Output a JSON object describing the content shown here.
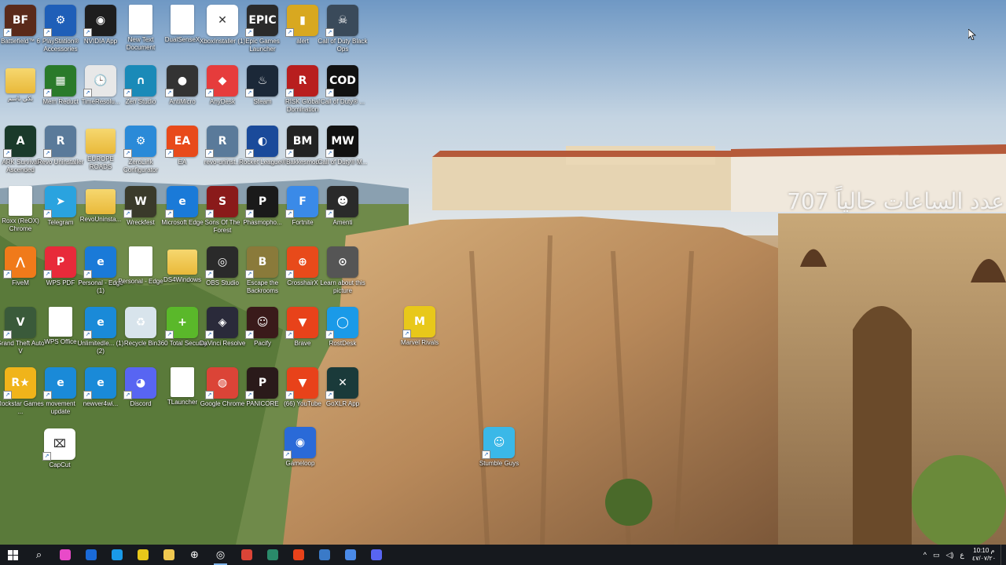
{
  "desktop": {
    "overlay_text": "عدد الساعات حالياً 707",
    "icons": [
      {
        "label": "Battlefield™ 6",
        "kind": "app",
        "color": "#5a2a1a",
        "glyph": "BF",
        "shortcut": true
      },
      {
        "label": "PlayStation® Accessories",
        "kind": "app",
        "color": "#1f5fb8",
        "glyph": "⚙",
        "shortcut": true
      },
      {
        "label": "NVIDIA App",
        "kind": "app",
        "color": "#1e1e1e",
        "glyph": "◉",
        "shortcut": true
      },
      {
        "label": "New Text Document",
        "kind": "file",
        "color": "#ffffff",
        "glyph": "",
        "shortcut": false
      },
      {
        "label": "DualSenseX",
        "kind": "file",
        "color": "#ffffff",
        "glyph": "",
        "shortcut": false
      },
      {
        "label": "XboxInstaller (1)",
        "kind": "app",
        "color": "#ffffff",
        "glyph": "✕",
        "shortcut": false
      },
      {
        "label": "Epic Games Launcher",
        "kind": "app",
        "color": "#2a2a2a",
        "glyph": "EPIC",
        "shortcut": true
      },
      {
        "label": "alert",
        "kind": "app",
        "color": "#d8a820",
        "glyph": "▮",
        "shortcut": true
      },
      {
        "label": "Call of Duty Black Ops",
        "kind": "app",
        "color": "#3a4a5a",
        "glyph": "☠",
        "shortcut": true
      },
      {
        "label": "بكي باسم",
        "kind": "folder",
        "color": "#f0c850",
        "glyph": "",
        "shortcut": false
      },
      {
        "label": "Mem Reduct",
        "kind": "app",
        "color": "#2a7a2a",
        "glyph": "▦",
        "shortcut": true
      },
      {
        "label": "TimeResolu...",
        "kind": "app",
        "color": "#e8e8e8",
        "glyph": "🕒",
        "shortcut": true
      },
      {
        "label": "Zen Studio",
        "kind": "app",
        "color": "#1a8ab8",
        "glyph": "∩",
        "shortcut": true
      },
      {
        "label": "AntiMicro",
        "kind": "app",
        "color": "#333333",
        "glyph": "●",
        "shortcut": true
      },
      {
        "label": "AnyDesk",
        "kind": "app",
        "color": "#e63c3c",
        "glyph": "◆",
        "shortcut": true
      },
      {
        "label": "Steam",
        "kind": "app",
        "color": "#1b2838",
        "glyph": "♨",
        "shortcut": true
      },
      {
        "label": "RISK Global Domination",
        "kind": "app",
        "color": "#b81e1e",
        "glyph": "R",
        "shortcut": true
      },
      {
        "label": "Call of Duty® ...",
        "kind": "app",
        "color": "#111111",
        "glyph": "COD",
        "shortcut": true
      },
      {
        "label": "ARK Survival Ascended",
        "kind": "app",
        "color": "#1a3a2a",
        "glyph": "A",
        "shortcut": true
      },
      {
        "label": "Revo Uninstaller",
        "kind": "app",
        "color": "#5a7a9a",
        "glyph": "R",
        "shortcut": true
      },
      {
        "label": "EUROPE ROADS",
        "kind": "folder",
        "color": "#f0c850",
        "glyph": "",
        "shortcut": false
      },
      {
        "label": "ZeroLink Configurator",
        "kind": "app",
        "color": "#2a8ad8",
        "glyph": "⚙",
        "shortcut": true
      },
      {
        "label": "EA",
        "kind": "app",
        "color": "#e84a1a",
        "glyph": "EA",
        "shortcut": true
      },
      {
        "label": "revo-uninst...",
        "kind": "app",
        "color": "#5a7a9a",
        "glyph": "R",
        "shortcut": true
      },
      {
        "label": "Rocket League®",
        "kind": "app",
        "color": "#1a4a9a",
        "glyph": "◐",
        "shortcut": true
      },
      {
        "label": "Bakkesmod",
        "kind": "app",
        "color": "#222222",
        "glyph": "BM",
        "shortcut": true
      },
      {
        "label": "Call of Duty® M...",
        "kind": "app",
        "color": "#111111",
        "glyph": "MW",
        "shortcut": true
      },
      {
        "label": "Roxx (ReOX) Chrome",
        "kind": "file",
        "color": "#ffffff",
        "glyph": "",
        "shortcut": false
      },
      {
        "label": "Telegram",
        "kind": "app",
        "color": "#2aa3df",
        "glyph": "➤",
        "shortcut": true
      },
      {
        "label": "RevoUninsta...",
        "kind": "folder",
        "color": "#f0c850",
        "glyph": "",
        "shortcut": false
      },
      {
        "label": "Wreckfest",
        "kind": "app",
        "color": "#3a3a2a",
        "glyph": "W",
        "shortcut": true
      },
      {
        "label": "Microsoft Edge",
        "kind": "app",
        "color": "#1a7ad8",
        "glyph": "e",
        "shortcut": true
      },
      {
        "label": "Sons Of The Forest",
        "kind": "app",
        "color": "#8a1a1a",
        "glyph": "S",
        "shortcut": true
      },
      {
        "label": "Phasmopho...",
        "kind": "app",
        "color": "#1a1a1a",
        "glyph": "P",
        "shortcut": true
      },
      {
        "label": "Fortnite",
        "kind": "app",
        "color": "#3a8ae8",
        "glyph": "F",
        "shortcut": true
      },
      {
        "label": "Amenti",
        "kind": "app",
        "color": "#2a2a2a",
        "glyph": "☻",
        "shortcut": true
      },
      {
        "label": "FiveM",
        "kind": "app",
        "color": "#f07a1a",
        "glyph": "⋀",
        "shortcut": true
      },
      {
        "label": "WPS PDF",
        "kind": "app",
        "color": "#e82a3a",
        "glyph": "P",
        "shortcut": true
      },
      {
        "label": "Personal - Edge (1)",
        "kind": "app",
        "color": "#1a7ad8",
        "glyph": "e",
        "shortcut": true
      },
      {
        "label": "Personal - Edge",
        "kind": "file",
        "color": "#ffffff",
        "glyph": "",
        "shortcut": false
      },
      {
        "label": "DS4Windows",
        "kind": "folder",
        "color": "#f0c850",
        "glyph": "",
        "shortcut": false
      },
      {
        "label": "OBS Studio",
        "kind": "app",
        "color": "#2a2a2a",
        "glyph": "◎",
        "shortcut": true
      },
      {
        "label": "Escape the Backrooms",
        "kind": "app",
        "color": "#8a7a3a",
        "glyph": "B",
        "shortcut": true
      },
      {
        "label": "CrosshairX",
        "kind": "app",
        "color": "#e84a1a",
        "glyph": "⊕",
        "shortcut": true
      },
      {
        "label": "Learn about this picture",
        "kind": "app",
        "color": "#555555",
        "glyph": "⊙",
        "shortcut": false
      },
      {
        "label": "Grand Theft Auto V",
        "kind": "app",
        "color": "#3a5a3a",
        "glyph": "V",
        "shortcut": true
      },
      {
        "label": "WPS Office",
        "kind": "file",
        "color": "#ffffff",
        "glyph": "",
        "shortcut": false
      },
      {
        "label": "UnlimitedIe... (1) (2)",
        "kind": "app",
        "color": "#1a8ad8",
        "glyph": "e",
        "shortcut": true
      },
      {
        "label": "Recycle Bin",
        "kind": "app",
        "color": "#d8e4ec",
        "glyph": "♻",
        "shortcut": false
      },
      {
        "label": "360 Total Security",
        "kind": "app",
        "color": "#5ab82a",
        "glyph": "+",
        "shortcut": true
      },
      {
        "label": "DaVinci Resolve",
        "kind": "app",
        "color": "#2a2a3a",
        "glyph": "◈",
        "shortcut": true
      },
      {
        "label": "Pacify",
        "kind": "app",
        "color": "#3a1a1a",
        "glyph": "☺",
        "shortcut": true
      },
      {
        "label": "Brave",
        "kind": "app",
        "color": "#e8421a",
        "glyph": "▼",
        "shortcut": true
      },
      {
        "label": "RostDesk",
        "kind": "app",
        "color": "#1a9ae8",
        "glyph": "◯",
        "shortcut": true
      },
      {
        "label": "Rockstar Games ...",
        "kind": "app",
        "color": "#f0b41a",
        "glyph": "R★",
        "shortcut": true
      },
      {
        "label": "movement update",
        "kind": "app",
        "color": "#1a8ad8",
        "glyph": "e",
        "shortcut": true
      },
      {
        "label": "newver4wi...",
        "kind": "app",
        "color": "#1a8ad8",
        "glyph": "e",
        "shortcut": true
      },
      {
        "label": "Discord",
        "kind": "app",
        "color": "#5865f2",
        "glyph": "◕",
        "shortcut": true
      },
      {
        "label": "TLauncher",
        "kind": "file",
        "color": "#ffffff",
        "glyph": "",
        "shortcut": false
      },
      {
        "label": "Google Chrome",
        "kind": "app",
        "color": "#db4437",
        "glyph": "◍",
        "shortcut": true
      },
      {
        "label": "PANICORE",
        "kind": "app",
        "color": "#2a1a1a",
        "glyph": "P",
        "shortcut": true
      },
      {
        "label": "(66) YouTube",
        "kind": "app",
        "color": "#e8421a",
        "glyph": "▼",
        "shortcut": true
      },
      {
        "label": "GoXLR App",
        "kind": "app",
        "color": "#1a3a3a",
        "glyph": "✕",
        "shortcut": true
      },
      {
        "label": "CapCut",
        "kind": "app",
        "color": "#ffffff",
        "glyph": "⌧",
        "shortcut": true
      },
      {
        "label": "Gameloop",
        "kind": "app",
        "color": "#2a6ad8",
        "glyph": "◉",
        "shortcut": true
      },
      {
        "label": "Marvel Rivals",
        "kind": "app",
        "color": "#e8c81a",
        "glyph": "M",
        "shortcut": true
      },
      {
        "label": "Stumble Guys",
        "kind": "app",
        "color": "#3ab8e8",
        "glyph": "☺",
        "shortcut": true
      }
    ]
  },
  "taskbar": {
    "start_label": "Start",
    "items": [
      {
        "name": "search-icon",
        "glyph": "⌕",
        "color": ""
      },
      {
        "name": "copilot-icon",
        "glyph": "",
        "color": "#e84ac8"
      },
      {
        "name": "outlook-icon",
        "glyph": "",
        "color": "#1a6ad8"
      },
      {
        "name": "edge-icon",
        "glyph": "",
        "color": "#1a9ae8"
      },
      {
        "name": "store-icon",
        "glyph": "",
        "color": "#e8c81a"
      },
      {
        "name": "file-explorer-icon",
        "glyph": "",
        "color": "#f0c850"
      },
      {
        "name": "crosshair-icon",
        "glyph": "⊕",
        "color": ""
      },
      {
        "name": "obs-icon",
        "glyph": "◎",
        "color": ""
      },
      {
        "name": "chrome-icon",
        "glyph": "",
        "color": "#db4437"
      },
      {
        "name": "goxlr-icon",
        "glyph": "",
        "color": "#2a8a6a"
      },
      {
        "name": "brave-icon",
        "glyph": "",
        "color": "#e8421a"
      },
      {
        "name": "steam-icon",
        "glyph": "",
        "color": "#3a7ac8"
      },
      {
        "name": "vpn-icon",
        "glyph": "",
        "color": "#4a8ae8"
      },
      {
        "name": "discord-icon",
        "glyph": "",
        "color": "#5865f2"
      }
    ],
    "tray": {
      "chevron": "^",
      "network": "▭",
      "volume": "◁)",
      "language": "ع",
      "time": "10:10 م",
      "date": "٤٧/٠٧/٢٠"
    }
  },
  "colors": {
    "taskbar_bg": "#16191e",
    "active_underline": "#7eb4ea"
  }
}
